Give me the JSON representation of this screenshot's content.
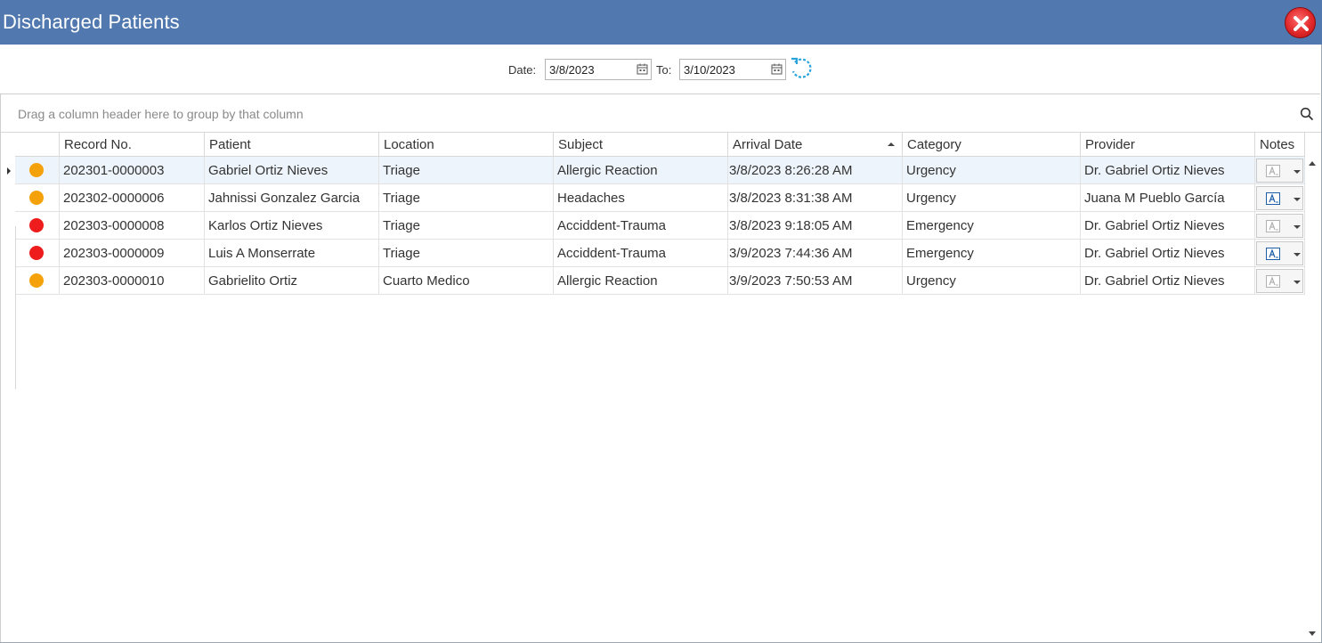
{
  "window": {
    "title": "Discharged Patients"
  },
  "filter": {
    "date_label": "Date:",
    "date_from": "3/8/2023",
    "to_label": "To:",
    "date_to": "3/10/2023"
  },
  "grid": {
    "group_hint": "Drag a column header here to group by that column",
    "columns": {
      "status": "",
      "record": "Record No.",
      "patient": "Patient",
      "location": "Location",
      "subject": "Subject",
      "arrival": "Arrival Date",
      "category": "Category",
      "provider": "Provider",
      "notes": "Notes"
    },
    "sorted_column": "Arrival Date",
    "sort_direction": "ascending",
    "rows": [
      {
        "status_color": "#f5a20a",
        "record": "202301-0000003",
        "patient": "Gabriel Ortiz Nieves",
        "location": "Triage",
        "subject": "Allergic Reaction",
        "arrival": "3/8/2023 8:26:28 AM",
        "category": "Urgency",
        "provider": "Dr. Gabriel Ortiz Nieves",
        "has_notes": false
      },
      {
        "status_color": "#f5a20a",
        "record": "202302-0000006",
        "patient": "Jahnissi Gonzalez Garcia",
        "location": "Triage",
        "subject": "Headaches",
        "arrival": "3/8/2023 8:31:38 AM",
        "category": "Urgency",
        "provider": "Juana M Pueblo García",
        "has_notes": true
      },
      {
        "status_color": "#ee1c1c",
        "record": "202303-0000008",
        "patient": "Karlos Ortiz Nieves",
        "location": "Triage",
        "subject": "Acciddent-Trauma",
        "arrival": "3/8/2023 9:18:05 AM",
        "category": "Emergency",
        "provider": "Dr. Gabriel Ortiz Nieves",
        "has_notes": false
      },
      {
        "status_color": "#ee1c1c",
        "record": "202303-0000009",
        "patient": "Luis A Monserrate",
        "location": "Triage",
        "subject": "Acciddent-Trauma",
        "arrival": "3/9/2023 7:44:36 AM",
        "category": "Emergency",
        "provider": "Dr. Gabriel Ortiz Nieves",
        "has_notes": true
      },
      {
        "status_color": "#f5a20a",
        "record": "202303-0000010",
        "patient": "Gabrielito Ortiz",
        "location": "Cuarto Medico",
        "subject": "Allergic Reaction",
        "arrival": "3/9/2023 7:50:53 AM",
        "category": "Urgency",
        "provider": "Dr. Gabriel Ortiz Nieves",
        "has_notes": false
      }
    ]
  },
  "colors": {
    "titlebar": "#5179b0",
    "urgency": "#f5a20a",
    "emergency": "#ee1c1c",
    "selected_row": "#eef4fb"
  },
  "icons": {
    "close": "close-icon",
    "calendar": "calendar-icon",
    "refresh": "refresh-icon",
    "search": "search-icon",
    "notes": "note-icon"
  }
}
